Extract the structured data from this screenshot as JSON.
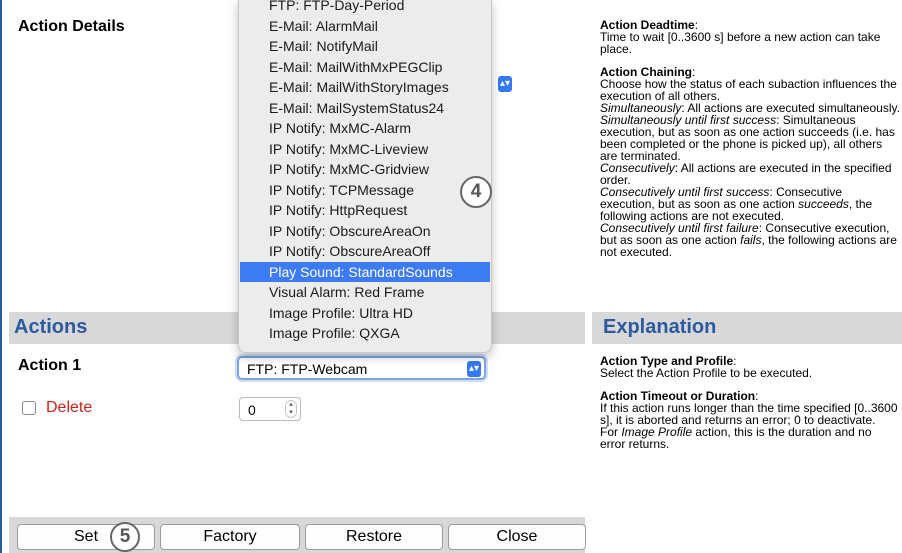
{
  "page": {
    "section_title": "Action Details",
    "actions_header": "Actions",
    "explanation_header": "Explanation",
    "action1_label": "Action 1",
    "action1_select_value": "FTP: FTP-Webcam",
    "delete_label": "Delete",
    "delete_checked": false,
    "timeout_value": "0"
  },
  "dropdown": {
    "options": [
      "FTP: FTP-Day-Period",
      "E-Mail: AlarmMail",
      "E-Mail: NotifyMail",
      "E-Mail: MailWithMxPEGClip",
      "E-Mail: MailWithStoryImages",
      "E-Mail: MailSystemStatus24",
      "IP Notify: MxMC-Alarm",
      "IP Notify: MxMC-Liveview",
      "IP Notify: MxMC-Gridview",
      "IP Notify: TCPMessage",
      "IP Notify: HttpRequest",
      "IP Notify: ObscureAreaOn",
      "IP Notify: ObscureAreaOff",
      "Play Sound: StandardSounds",
      "Visual Alarm: Red Frame",
      "Image Profile: Ultra HD",
      "Image Profile: QXGA"
    ],
    "selected_index": 13
  },
  "explanation_top": {
    "deadtime_title": "Action Deadtime",
    "deadtime_text": "Time to wait [0..3600 s] before a new action can take place.",
    "chaining_title": "Action Chaining",
    "chaining_text": "Choose how the status of each subaction influences the execution of all others.",
    "simul_term": "Simultaneously",
    "simul_text": ": All actions are executed simultaneously.",
    "simul_first_term": "Simultaneously until first success",
    "simul_first_text": ": Simultaneous execution, but as soon as one action succeeds (i.e. has been completed or the phone is picked up), all others are terminated.",
    "consec_term": "Consecutively",
    "consec_text": ": All actions are executed in the specified order.",
    "consec_success_term": "Consecutively until first success",
    "consec_success_text_a": ": Consecutive execution, but as soon as one action ",
    "consec_success_em": "succeeds",
    "consec_success_text_b": ", the following actions are not executed.",
    "consec_failure_term": "Consecutively until first failure",
    "consec_failure_text_a": ": Consecutive execution, but as soon as one action ",
    "consec_failure_em": "fails",
    "consec_failure_text_b": ", the following actions are not executed."
  },
  "explanation_bottom": {
    "type_title": "Action Type and Profile",
    "type_text": "Select the Action Profile to be executed.",
    "timeout_title": "Action Timeout or Duration",
    "timeout_text": "If this action runs longer than the time specified [0..3600 s], it is aborted and returns an error; 0 to deactivate.",
    "profile_text_a": "For ",
    "profile_em": "Image Profile",
    "profile_text_b": " action, this is the duration and no error returns."
  },
  "buttons": {
    "set": "Set",
    "factory": "Factory",
    "restore": "Restore",
    "close": "Close"
  },
  "callouts": {
    "four": "4",
    "five": "5"
  },
  "icons": {
    "select_stepper": "up-down-chevron-icon",
    "spinner": "spinner-arrows-icon"
  }
}
